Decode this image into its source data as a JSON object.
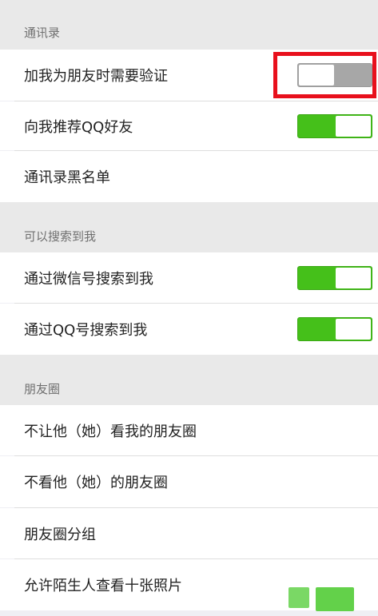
{
  "sections": [
    {
      "header": "通讯录",
      "rows": [
        {
          "label": "加我为朋友时需要验证",
          "toggle": false
        },
        {
          "label": "向我推荐QQ好友",
          "toggle": true
        },
        {
          "label": "通讯录黑名单"
        }
      ]
    },
    {
      "header": "可以搜索到我",
      "rows": [
        {
          "label": "通过微信号搜索到我",
          "toggle": true
        },
        {
          "label": "通过QQ号搜索到我",
          "toggle": true
        }
      ]
    },
    {
      "header": "朋友圈",
      "rows": [
        {
          "label": "不让他（她）看我的朋友圈"
        },
        {
          "label": "不看他（她）的朋友圈"
        },
        {
          "label": "朋友圈分组"
        },
        {
          "label": "允许陌生人查看十张照片"
        }
      ]
    }
  ],
  "colors": {
    "toggle_on": "#45c01a",
    "toggle_off": "#a7a7a7",
    "highlight_box": "#e8101c",
    "section_bg": "#e9e9e9"
  }
}
